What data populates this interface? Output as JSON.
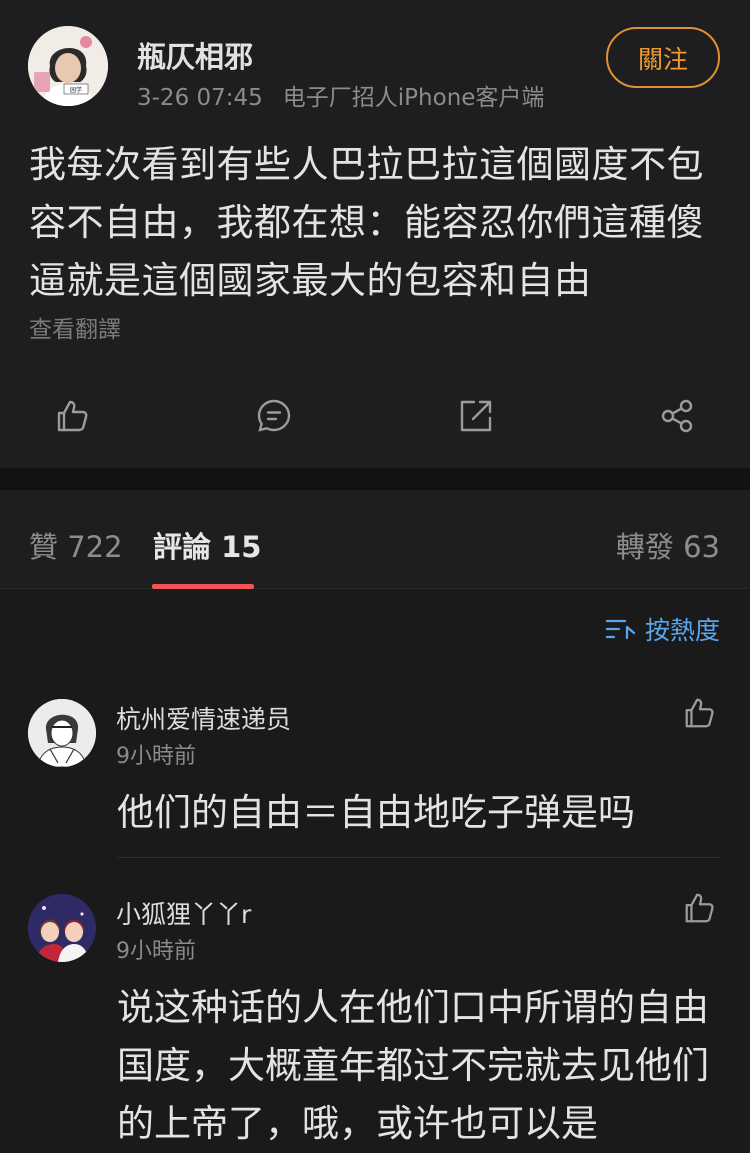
{
  "post": {
    "author": "瓶仄相邪",
    "time": "3-26 07:45",
    "source": "电子厂招人iPhone客户端",
    "follow_label": "關注",
    "text": "我每次看到有些人巴拉巴拉這個國度不包容不自由，我都在想：能容忍你們這種傻逼就是這個國家最大的包容和自由",
    "translate_label": "查看翻譯",
    "avatar_caption": "园学"
  },
  "tabs": {
    "likes": "贊 722",
    "comments": "評論 15",
    "reposts": "轉發 63"
  },
  "sort": {
    "label": "按熱度"
  },
  "comments": [
    {
      "name": "杭州爱情速递员",
      "time": "9小時前",
      "text": "他们的自由＝自由地吃子弹是吗"
    },
    {
      "name": "小狐狸丫丫r",
      "time": "9小時前",
      "text": "说这种话的人在他们口中所谓的自由国度，大概童年都过不完就去见他们的上帝了，哦，或许也可以是"
    }
  ],
  "icons": {
    "like": "thumbs-up-icon",
    "comment": "comment-bubble-icon",
    "repost": "repost-arrow-icon",
    "share": "share-nodes-icon",
    "sort": "sort-lines-icon"
  },
  "colors": {
    "accent_orange": "#f09a33",
    "tab_indicator": "#f05454",
    "link_blue": "#5aa6ee"
  }
}
